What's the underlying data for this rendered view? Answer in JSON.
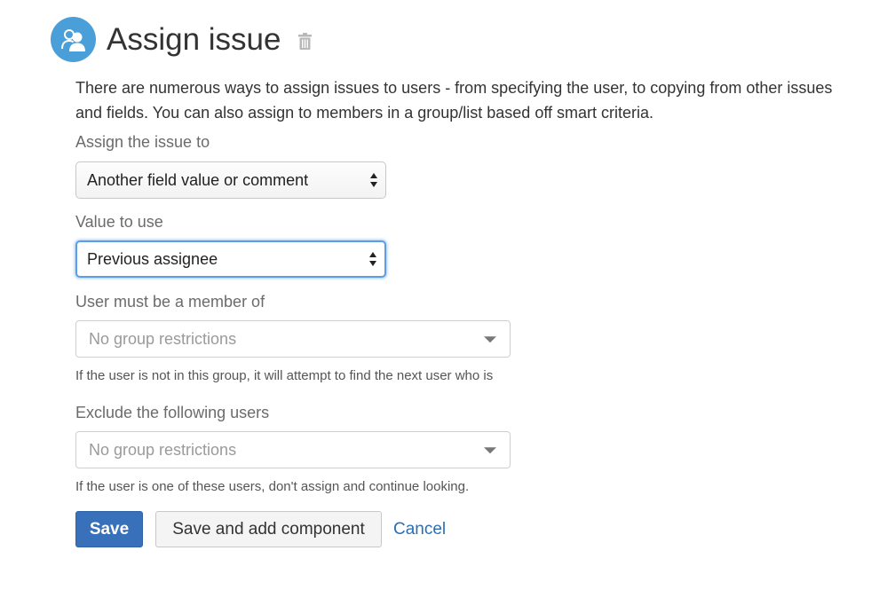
{
  "header": {
    "title": "Assign issue",
    "avatar_icon": "users-icon",
    "delete_icon": "trash-icon",
    "avatar_color": "#4a9fd8"
  },
  "description": "There are numerous ways to assign issues to users - from specifying the user, to copying from other issues and fields. You can also assign to members in a group/list based off smart criteria.",
  "assign_to": {
    "label": "Assign the issue to",
    "value": "Another field value or comment"
  },
  "value_to_use": {
    "label": "Value to use",
    "value": "Previous assignee"
  },
  "member_of": {
    "label": "User must be a member of",
    "placeholder": "No group restrictions",
    "help": "If the user is not in this group, it will attempt to find the next user who is"
  },
  "exclude_users": {
    "label": "Exclude the following users",
    "placeholder": "No group restrictions",
    "help": "If the user is one of these users, don't assign and continue looking."
  },
  "actions": {
    "save_label": "Save",
    "save_add_label": "Save and add component",
    "cancel_label": "Cancel",
    "primary_color": "#3871b9",
    "link_color": "#2a6fb5"
  }
}
